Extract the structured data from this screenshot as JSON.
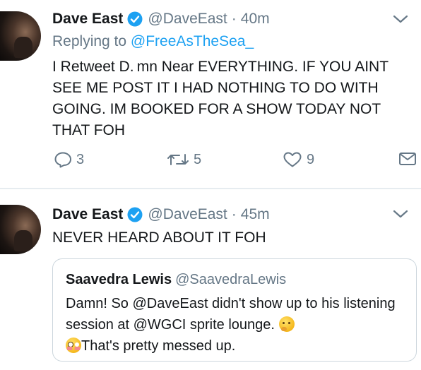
{
  "tweets": [
    {
      "author_name": "Dave East",
      "handle": "@DaveEast",
      "separator": "·",
      "time": "40m",
      "replying_prefix": "Replying to",
      "replying_to": "@FreeAsTheSea_",
      "text": "I Retweet D. mn Near EVERYTHING. IF YOU AINT SEE ME POST IT I HAD NOTHING TO DO WITH GOING. IM BOOKED FOR A SHOW TODAY NOT THAT FOH",
      "reply_count": "3",
      "retweet_count": "5",
      "like_count": "9"
    },
    {
      "author_name": "Dave East",
      "handle": "@DaveEast",
      "separator": "·",
      "time": "45m",
      "text": "NEVER HEARD ABOUT IT FOH",
      "quote": {
        "author_name": "Saavedra Lewis",
        "handle": "@SaavedraLewis",
        "text_part1": "Damn! So @DaveEast didn't show up to his listening session at @WGCI sprite lounge. ",
        "text_part2": "That's pretty messed up."
      }
    }
  ],
  "icons": {
    "verified": "verified-badge-icon",
    "menu": "chevron-down-icon",
    "reply": "reply-icon",
    "retweet": "retweet-icon",
    "like": "heart-icon",
    "dm": "envelope-icon",
    "emoji1": "thinking-face-emoji",
    "emoji2": "flushed-face-emoji"
  },
  "colors": {
    "text": "#14171a",
    "muted": "#657786",
    "link": "#1da1f2",
    "border": "#ccd6dd"
  }
}
